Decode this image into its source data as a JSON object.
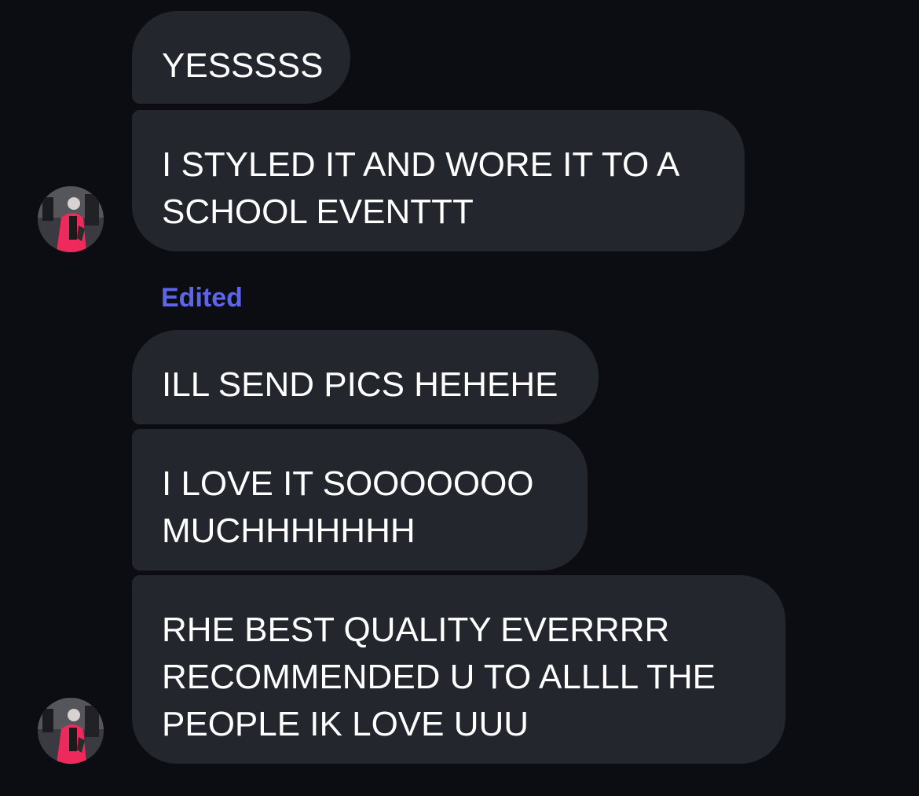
{
  "messages": [
    {
      "lines": [
        "YESSSSS"
      ]
    },
    {
      "lines": [
        "I STYLED IT AND WORE IT TO A",
        "SCHOOL EVENTTT"
      ]
    },
    {
      "lines": [
        "ILL SEND PICS HEHEHE"
      ]
    },
    {
      "lines": [
        "I LOVE IT SOOOOOOO",
        "MUCHHHHHHH"
      ]
    },
    {
      "lines": [
        "RHE BEST QUALITY EVERRRR",
        "RECOMMENDED U TO ALLLL THE",
        "PEOPLE IK LOVE UUU"
      ]
    }
  ],
  "edited_label": "Edited",
  "colors": {
    "background": "#0b0d13",
    "bubble": "#24262d",
    "text": "#ffffff",
    "edited": "#5d66e8"
  },
  "avatar_icon": "profile-photo-avatar"
}
